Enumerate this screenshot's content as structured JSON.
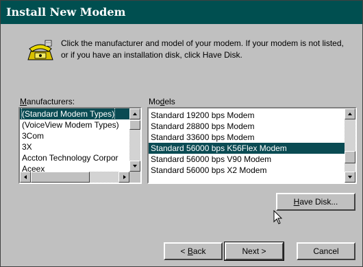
{
  "window": {
    "title": "Install New Modem"
  },
  "instruction": {
    "line1": "Click the manufacturer and model of your modem. If your modem is not listed,",
    "line2": "or if you have an installation disk, click Have Disk."
  },
  "manufacturers": {
    "label_accel": "M",
    "label_rest": "anufacturers:",
    "items": [
      "(Standard Modem Types)",
      "(VoiceView Modem Types)",
      "3Com",
      "3X",
      "Accton Technology Corpor",
      "Aceex"
    ],
    "selected_index": 0
  },
  "models": {
    "label_pre": "Mo",
    "label_accel": "d",
    "label_rest": "els",
    "items": [
      "Standard 19200 bps Modem",
      "Standard 28800 bps Modem",
      "Standard 33600 bps Modem",
      "Standard 56000 bps K56Flex Modem",
      "Standard 56000 bps V90 Modem",
      "Standard 56000 bps X2 Modem"
    ],
    "selected_index": 3
  },
  "buttons": {
    "have_disk_accel": "H",
    "have_disk_rest": "ave Disk...",
    "back_pre": "< ",
    "back_accel": "B",
    "back_rest": "ack",
    "next": "Next >",
    "cancel": "Cancel"
  },
  "colors": {
    "title_bar": "#004f50",
    "selection": "#0a4b53",
    "face": "#c0c0c0"
  }
}
